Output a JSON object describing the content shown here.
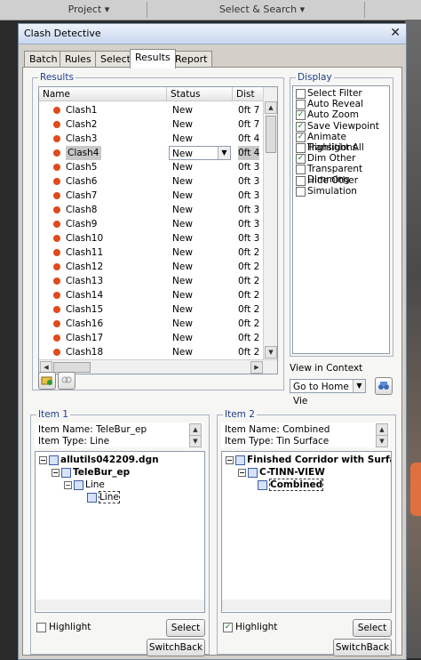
{
  "topbar": {
    "left": "Project",
    "mid": "Select & Search"
  },
  "dialog": {
    "title": "Clash Detective",
    "close_glyph": "✕"
  },
  "tabs": [
    {
      "label": "Batch"
    },
    {
      "label": "Rules"
    },
    {
      "label": "Select"
    },
    {
      "label": "Results",
      "active": true
    },
    {
      "label": "Report"
    }
  ],
  "results": {
    "group_label": "Results",
    "columns": [
      "Name",
      "Status",
      "Dist"
    ],
    "rows": [
      {
        "name": "Clash1",
        "status": "New",
        "dist": "0ft 7"
      },
      {
        "name": "Clash2",
        "status": "New",
        "dist": "0ft 7"
      },
      {
        "name": "Clash3",
        "status": "New",
        "dist": "0ft 4"
      },
      {
        "name": "Clash4",
        "status": "New",
        "dist": "0ft 4",
        "selected": true
      },
      {
        "name": "Clash5",
        "status": "New",
        "dist": "0ft 3"
      },
      {
        "name": "Clash6",
        "status": "New",
        "dist": "0ft 3"
      },
      {
        "name": "Clash7",
        "status": "New",
        "dist": "0ft 3"
      },
      {
        "name": "Clash8",
        "status": "New",
        "dist": "0ft 3"
      },
      {
        "name": "Clash9",
        "status": "New",
        "dist": "0ft 3"
      },
      {
        "name": "Clash10",
        "status": "New",
        "dist": "0ft 3"
      },
      {
        "name": "Clash11",
        "status": "New",
        "dist": "0ft 2"
      },
      {
        "name": "Clash12",
        "status": "New",
        "dist": "0ft 2"
      },
      {
        "name": "Clash13",
        "status": "New",
        "dist": "0ft 2"
      },
      {
        "name": "Clash14",
        "status": "New",
        "dist": "0ft 2"
      },
      {
        "name": "Clash15",
        "status": "New",
        "dist": "0ft 2"
      },
      {
        "name": "Clash16",
        "status": "New",
        "dist": "0ft 2"
      },
      {
        "name": "Clash17",
        "status": "New",
        "dist": "0ft 2"
      },
      {
        "name": "Clash18",
        "status": "New",
        "dist": "0ft 2"
      }
    ],
    "status_color": "#e04a1c"
  },
  "display": {
    "group_label": "Display",
    "options": [
      {
        "label": "Select Filter",
        "checked": false
      },
      {
        "label": "Auto Reveal",
        "checked": false
      },
      {
        "label": "Auto Zoom",
        "checked": true
      },
      {
        "label": "Save Viewpoint",
        "checked": true
      },
      {
        "label": "Animate Transitions",
        "checked": true
      },
      {
        "label": "Highlight All",
        "checked": false
      },
      {
        "label": "Dim Other",
        "checked": true
      },
      {
        "label": "Transparent Dimming",
        "checked": false
      },
      {
        "label": "Hide Other",
        "checked": false
      },
      {
        "label": "Simulation",
        "checked": false
      }
    ],
    "view_in_context_label": "View in Context",
    "view_in_context_value": "Go to Home Vie"
  },
  "item1": {
    "group_label": "Item 1",
    "item_name": "Item Name: TeleBur_ep",
    "item_type": "Item Type: Line",
    "tree": [
      "allutils042209.dgn",
      "TeleBur_ep",
      "Line",
      "Line"
    ],
    "highlight_label": "Highlight",
    "highlight_checked": false,
    "select_label": "Select",
    "switchback_label": "SwitchBack"
  },
  "item2": {
    "group_label": "Item 2",
    "item_name": "Item Name: Combined",
    "item_type": "Item Type: Tin Surface",
    "tree": [
      "Finished Corridor with Surface",
      "C-TINN-VIEW",
      "Combined"
    ],
    "highlight_label": "Highlight",
    "highlight_checked": true,
    "select_label": "Select",
    "switchback_label": "SwitchBack"
  }
}
